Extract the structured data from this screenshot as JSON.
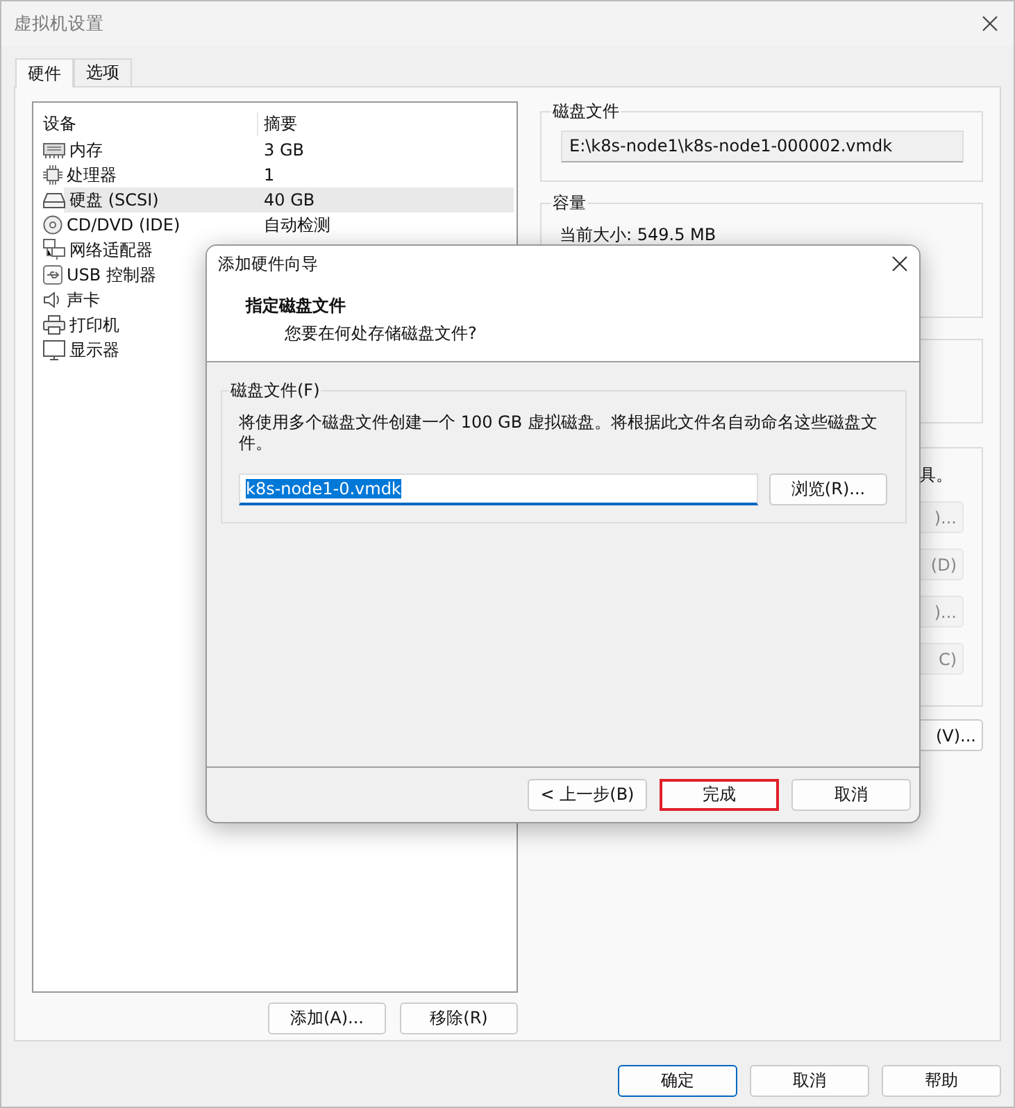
{
  "window": {
    "title": "虚拟机设置"
  },
  "tabs": [
    {
      "label": "硬件",
      "selected": true
    },
    {
      "label": "选项",
      "selected": false
    }
  ],
  "device_table": {
    "columns": [
      "设备",
      "摘要"
    ],
    "rows": [
      {
        "kind": "memory",
        "device": "内存",
        "summary": "3 GB",
        "selected": false
      },
      {
        "kind": "processor",
        "device": "处理器",
        "summary": "1",
        "selected": false
      },
      {
        "kind": "disk",
        "device": "硬盘 (SCSI)",
        "summary": "40 GB",
        "selected": true
      },
      {
        "kind": "cdrom",
        "device": "CD/DVD (IDE)",
        "summary": "自动检测",
        "selected": false
      },
      {
        "kind": "network",
        "device": "网络适配器",
        "selected": false
      },
      {
        "kind": "usb",
        "device": "USB 控制器",
        "selected": false
      },
      {
        "kind": "sound",
        "device": "声卡",
        "selected": false
      },
      {
        "kind": "printer",
        "device": "打印机",
        "selected": false
      },
      {
        "kind": "display",
        "device": "显示器",
        "selected": false
      }
    ]
  },
  "device_buttons": [
    "添加(A)...",
    "移除(R)"
  ],
  "disk_file": {
    "label": "磁盘文件",
    "value": "E:\\k8s-node1\\k8s-node1-000002.vmdk"
  },
  "capacity": {
    "label": "容量",
    "current_size": "当前大小: 549.5 MB"
  },
  "tools_group": {
    "text_fragment": "具。",
    "button_fragments": [
      ")...",
      "(D)",
      ")...",
      "C)"
    ]
  },
  "side_button_fragment": "(V)...",
  "footer_buttons": [
    {
      "label": "确定",
      "default": true
    },
    {
      "label": "取消",
      "default": false
    },
    {
      "label": "帮助",
      "default": false
    }
  ],
  "wizard": {
    "title": "添加硬件向导",
    "heading": "指定磁盘文件",
    "subheading": "您要在何处存储磁盘文件?",
    "group_label": "磁盘文件(F)",
    "description": "将使用多个磁盘文件创建一个 100 GB 虚拟磁盘。将根据此文件名自动命名这些磁盘文件。",
    "file_name": "k8s-node1-0.vmdk",
    "file_name_selected": true,
    "browse_button": "浏览(R)...",
    "buttons": [
      {
        "label": "< 上一步(B)",
        "highlighted": false
      },
      {
        "label": "完成",
        "highlighted": true
      },
      {
        "label": "取消",
        "highlighted": false
      }
    ]
  }
}
